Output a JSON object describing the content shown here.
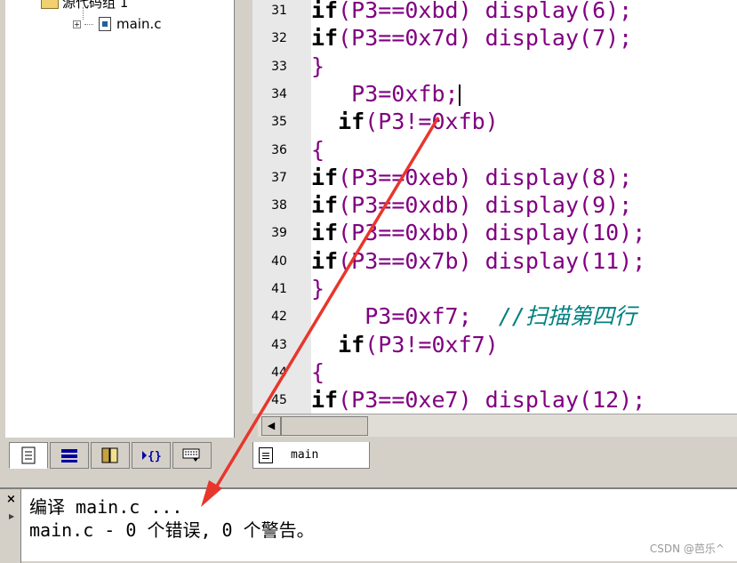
{
  "project_tree": {
    "group_label": "源代码组 1",
    "file_label": "main.c",
    "expand_glyph": "+"
  },
  "tree_tabs": [
    {
      "icon": "files-icon"
    },
    {
      "icon": "registers-icon"
    },
    {
      "icon": "books-icon"
    },
    {
      "icon": "functions-icon"
    },
    {
      "icon": "templates-icon"
    }
  ],
  "editor": {
    "lines": [
      {
        "num": "31",
        "indent": "",
        "parts": [
          {
            "t": "if",
            "c": "kw"
          },
          {
            "t": "(P3==0xbd) display(6);",
            "c": ""
          }
        ]
      },
      {
        "num": "32",
        "indent": "",
        "parts": [
          {
            "t": "if",
            "c": "kw"
          },
          {
            "t": "(P3==0x7d) display(7);",
            "c": ""
          }
        ]
      },
      {
        "num": "33",
        "indent": "",
        "parts": [
          {
            "t": "}",
            "c": ""
          }
        ]
      },
      {
        "num": "34",
        "indent": "   ",
        "parts": [
          {
            "t": "P3=0xfb;",
            "c": ""
          }
        ],
        "caret": true
      },
      {
        "num": "35",
        "indent": "  ",
        "parts": [
          {
            "t": "if",
            "c": "kw"
          },
          {
            "t": "(P3!=0xfb)",
            "c": ""
          }
        ]
      },
      {
        "num": "36",
        "indent": "",
        "parts": [
          {
            "t": "{",
            "c": ""
          }
        ]
      },
      {
        "num": "37",
        "indent": "",
        "parts": [
          {
            "t": "if",
            "c": "kw"
          },
          {
            "t": "(P3==0xeb) display(8);",
            "c": ""
          }
        ]
      },
      {
        "num": "38",
        "indent": "",
        "parts": [
          {
            "t": "if",
            "c": "kw"
          },
          {
            "t": "(P3==0xdb) display(9);",
            "c": ""
          }
        ]
      },
      {
        "num": "39",
        "indent": "",
        "parts": [
          {
            "t": "if",
            "c": "kw"
          },
          {
            "t": "(P3==0xbb) display(10);",
            "c": ""
          }
        ]
      },
      {
        "num": "40",
        "indent": "",
        "parts": [
          {
            "t": "if",
            "c": "kw"
          },
          {
            "t": "(P3==0x7b) display(11);",
            "c": ""
          }
        ]
      },
      {
        "num": "41",
        "indent": "",
        "parts": [
          {
            "t": "}",
            "c": ""
          }
        ]
      },
      {
        "num": "42",
        "indent": "    ",
        "parts": [
          {
            "t": "P3=0xf7;  ",
            "c": ""
          },
          {
            "t": "//扫描第四行",
            "c": "cm"
          }
        ]
      },
      {
        "num": "43",
        "indent": "  ",
        "parts": [
          {
            "t": "if",
            "c": "kw"
          },
          {
            "t": "(P3!=0xf7)",
            "c": ""
          }
        ]
      },
      {
        "num": "44",
        "indent": "",
        "parts": [
          {
            "t": "{",
            "c": ""
          }
        ]
      },
      {
        "num": "45",
        "indent": "",
        "parts": [
          {
            "t": "if",
            "c": "kw"
          },
          {
            "t": "(P3==0xe7) display(12);",
            "c": ""
          }
        ]
      }
    ]
  },
  "editor_tab": {
    "label": "main"
  },
  "output": {
    "line1": "编译 main.c ...",
    "line2": "main.c - 0 个错误, 0 个警告。",
    "close_glyph": "×"
  },
  "watermark": "CSDN @芭乐^",
  "colors": {
    "annotation_arrow": "#e8362c",
    "keyword": "#000000",
    "code": "#800080",
    "comment": "#008080"
  }
}
